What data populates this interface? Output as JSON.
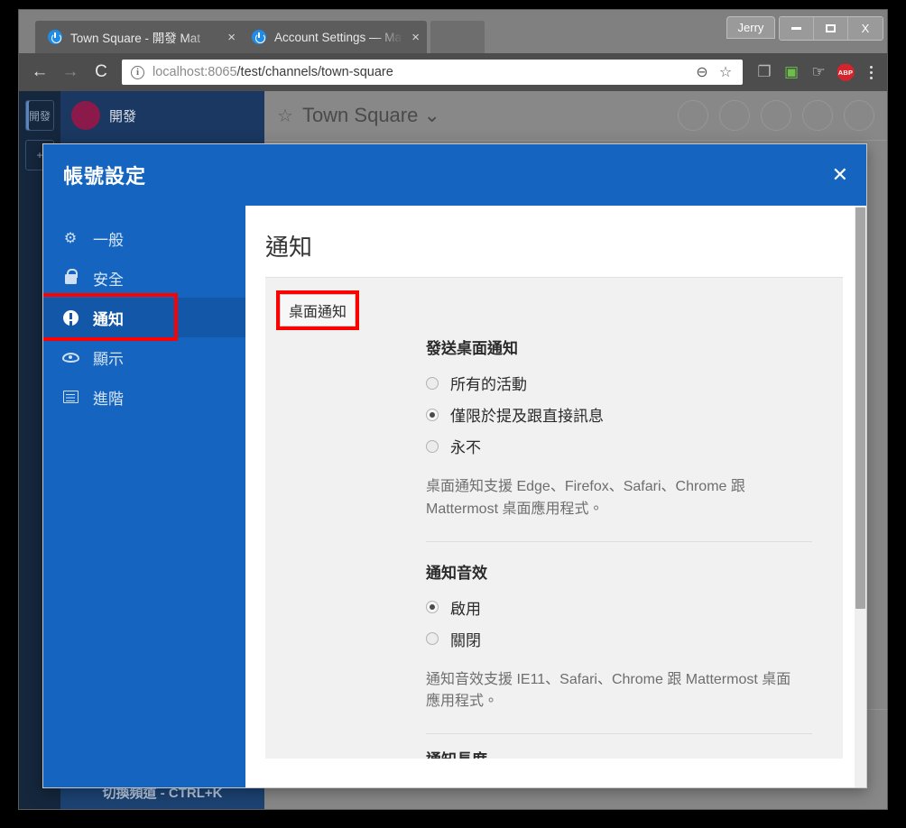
{
  "window": {
    "profile_label": "Jerry",
    "controls": [
      {
        "name": "minimize",
        "label": "–"
      },
      {
        "name": "maximize",
        "label": "□"
      },
      {
        "name": "close",
        "label": "X"
      }
    ]
  },
  "browser": {
    "tabs": [
      {
        "title": "Town Square - 開發 Mat",
        "close": "×",
        "favicon": "mattermost-icon"
      },
      {
        "title": "Account Settings — Ma",
        "close": "×",
        "favicon": "mattermost-icon"
      }
    ],
    "nav": {
      "back": "←",
      "forward": "→",
      "reload": "↻"
    },
    "omnibox": {
      "info_glyph": "i",
      "url_path": "localhost:8065",
      "url_rest": "/test/channels/town-square",
      "zoom_out_icon": "⊖",
      "bookmark_icon": "☆"
    },
    "extensions": [
      {
        "name": "tab-copy-icon",
        "glyph": "❐"
      },
      {
        "name": "screen-share-icon",
        "glyph": "▣"
      },
      {
        "name": "hand-pointer-icon",
        "glyph": "☞"
      },
      {
        "name": "adblock-plus-icon",
        "glyph": "ABP"
      }
    ],
    "menu_icon": "kebab-menu-icon"
  },
  "app_background": {
    "team_initial": "開發",
    "team_name": "開發",
    "channel_title": "Town Square",
    "channel_chevron": "⌄",
    "star_icon": "☆",
    "switch_channel": "切換頻道 - CTRL+K"
  },
  "modal": {
    "title": "帳號設定",
    "close_label": "✕",
    "nav_items": [
      {
        "label": "一般",
        "icon": "gear-icon",
        "active": false
      },
      {
        "label": "安全",
        "icon": "lock-icon",
        "active": false
      },
      {
        "label": "通知",
        "icon": "exclamation-circle-icon",
        "active": true
      },
      {
        "label": "顯示",
        "icon": "eye-icon",
        "active": false
      },
      {
        "label": "進階",
        "icon": "list-icon",
        "active": false
      }
    ],
    "pane": {
      "title": "通知",
      "section_tab": "桌面通知",
      "groups": [
        {
          "label": "發送桌面通知",
          "options": [
            {
              "label": "所有的活動",
              "checked": false
            },
            {
              "label": "僅限於提及跟直接訊息",
              "checked": true
            },
            {
              "label": "永不",
              "checked": false
            }
          ],
          "help": "桌面通知支援 Edge、Firefox、Safari、Chrome 跟 Mattermost 桌面應用程式。"
        },
        {
          "label": "通知音效",
          "options": [
            {
              "label": "啟用",
              "checked": true
            },
            {
              "label": "關閉",
              "checked": false
            }
          ],
          "help": "通知音效支援 IE11、Safari、Chrome 跟 Mattermost 桌面應用程式。"
        }
      ],
      "clipped_next_label": "通知長度"
    }
  },
  "colors": {
    "modal_blue": "#1565c0",
    "nav_active_blue": "#1257a8",
    "highlight_red": "#ff0000",
    "card_gray": "#f1f1f1"
  }
}
